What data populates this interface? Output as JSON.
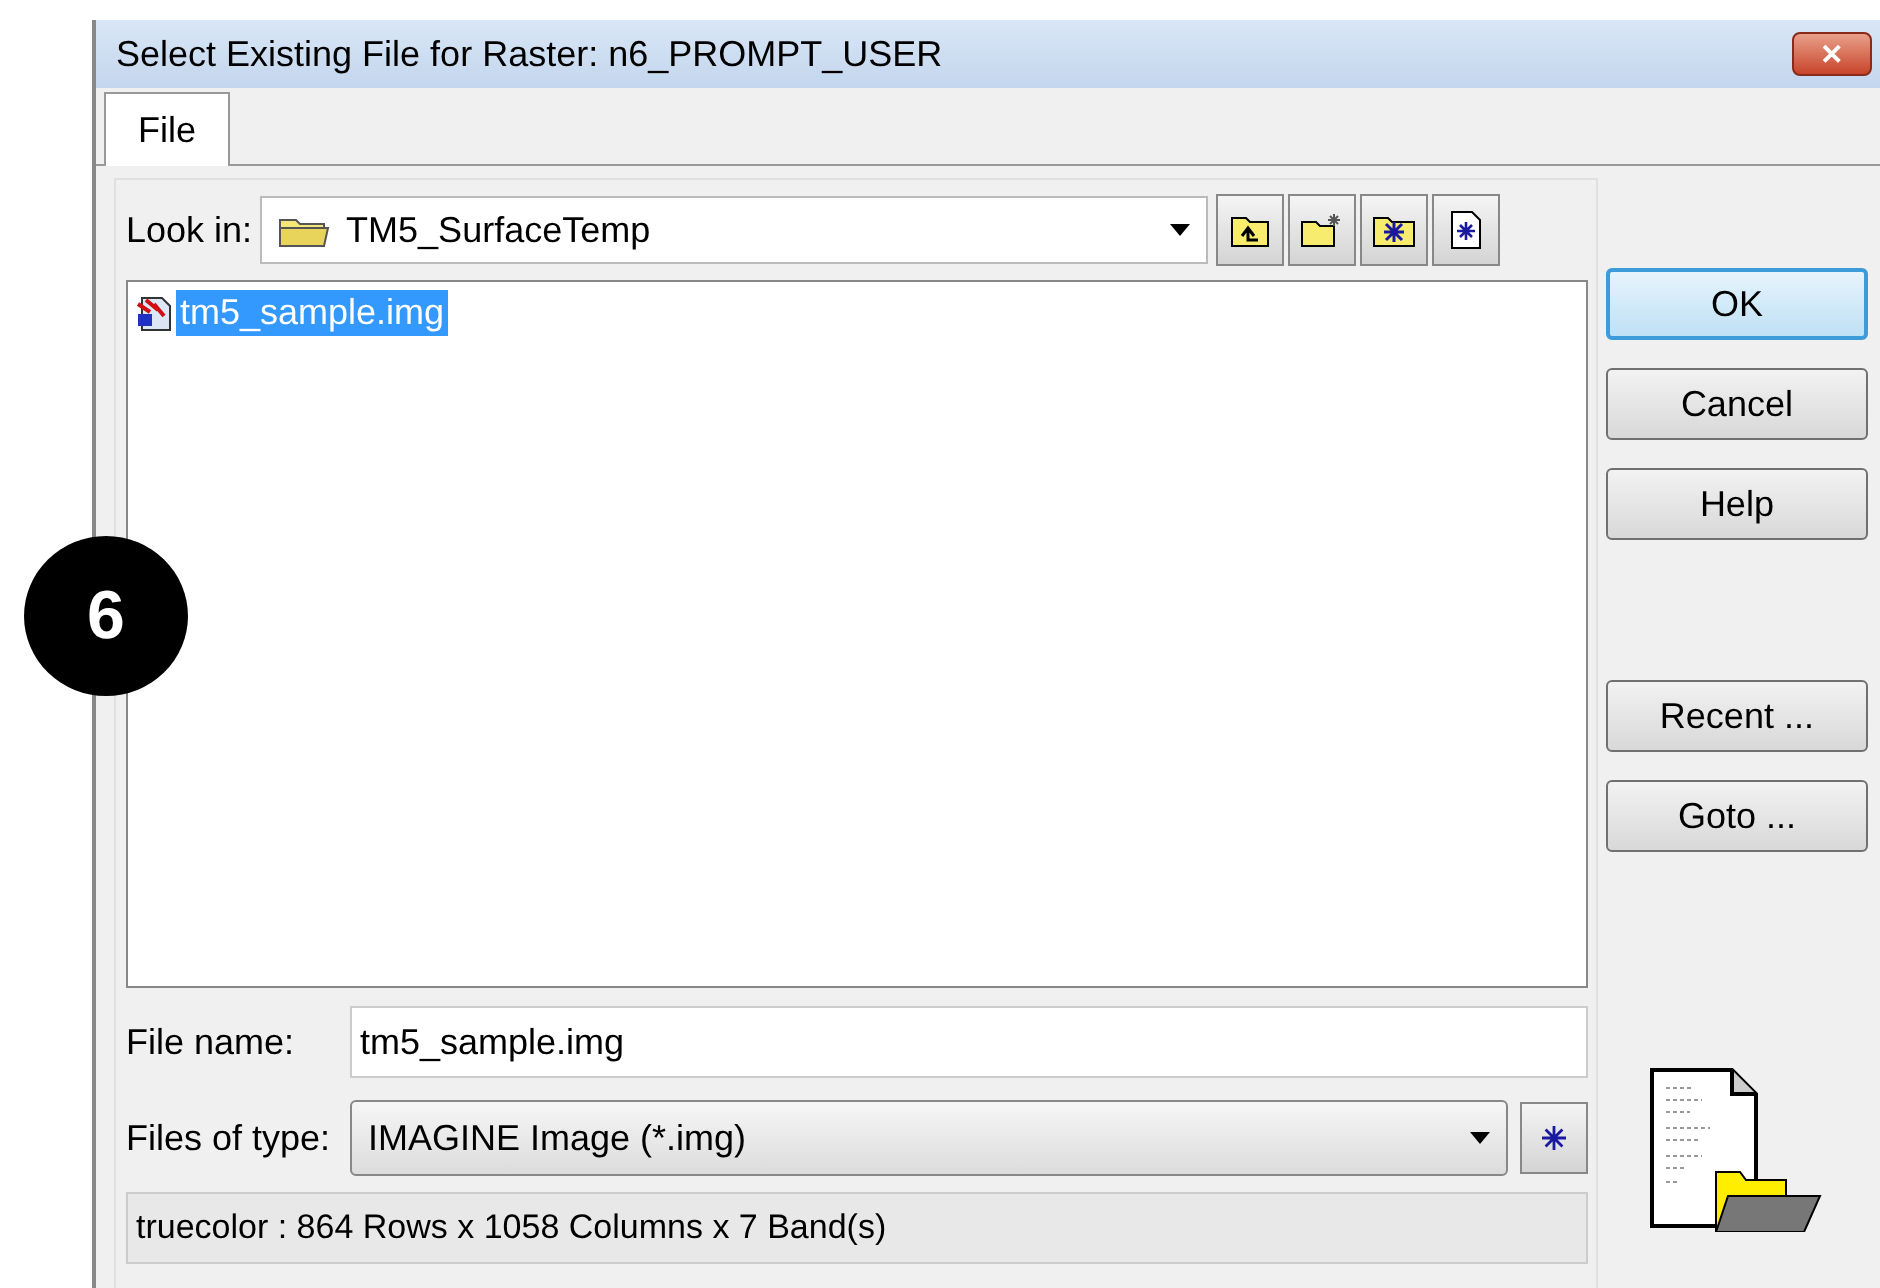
{
  "callout": {
    "label": "6"
  },
  "window": {
    "title": "Select Existing File for Raster:   n6_PROMPT_USER",
    "close": "✕"
  },
  "tabs": [
    {
      "label": "File",
      "selected": true
    }
  ],
  "look_in": {
    "label": "Look in:",
    "value": "TM5_SurfaceTemp"
  },
  "files": [
    {
      "name": "tm5_sample.img",
      "selected": true
    }
  ],
  "buttons": [
    {
      "label": "OK",
      "default": true
    },
    {
      "label": "Cancel",
      "default": false
    },
    {
      "label": "Help",
      "default": false
    },
    {
      "label": "Recent ...",
      "default": false
    },
    {
      "label": "Goto ...",
      "default": false
    }
  ],
  "file_name": {
    "label": "File name:",
    "value": "tm5_sample.img"
  },
  "file_type": {
    "label": "Files of type:",
    "value": "IMAGINE Image (*.img)"
  },
  "status_bar": {
    "text": "truecolor : 864 Rows x 1058 Columns x 7 Band(s)"
  }
}
